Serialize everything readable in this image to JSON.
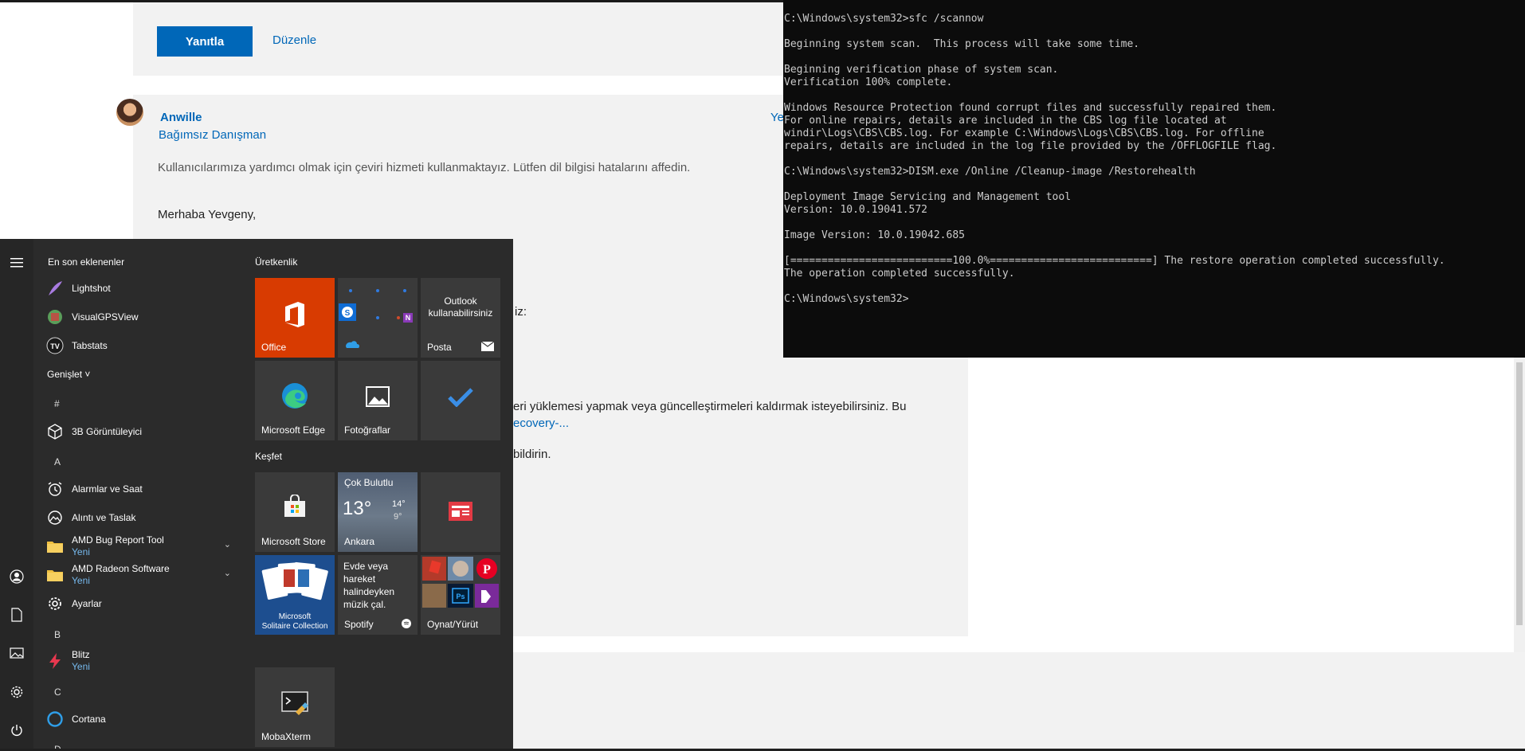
{
  "forum": {
    "reply_button": "Yanıtla",
    "edit_link": "Düzenle",
    "author_name": "Anwille",
    "author_role": "Bağımsız Danışman",
    "reply_edge": "Ye",
    "translation_note": "Kullanıcılarımıza yardımcı olmak için çeviri hizmeti kullanmaktayız. Lütfen dil bilgisi hatalarını affedin.",
    "greeting": "Merhaba Yevgeny,",
    "frag_1": "iz:",
    "frag_2": "eri yüklemesi yapmak veya güncelleştirmeleri kaldırmak isteyebilirsiniz. Bu",
    "frag_3": "ecovery-...",
    "frag_4": "bildirin."
  },
  "console": {
    "lines": [
      "C:\\Windows\\system32>sfc /scannow",
      "",
      "Beginning system scan.  This process will take some time.",
      "",
      "Beginning verification phase of system scan.",
      "Verification 100% complete.",
      "",
      "Windows Resource Protection found corrupt files and successfully repaired them.",
      "For online repairs, details are included in the CBS log file located at",
      "windir\\Logs\\CBS\\CBS.log. For example C:\\Windows\\Logs\\CBS\\CBS.log. For offline",
      "repairs, details are included in the log file provided by the /OFFLOGFILE flag.",
      "",
      "C:\\Windows\\system32>DISM.exe /Online /Cleanup-image /Restorehealth",
      "",
      "Deployment Image Servicing and Management tool",
      "Version: 10.0.19041.572",
      "",
      "Image Version: 10.0.19042.685",
      "",
      "[==========================100.0%==========================] The restore operation completed successfully.",
      "The operation completed successfully.",
      "",
      "C:\\Windows\\system32>"
    ]
  },
  "start_menu": {
    "recent_header": "En son eklenenler",
    "expand_label": "Genişlet ˅",
    "recent_apps": [
      "Lightshot",
      "VisualGPSView",
      "Tabstats"
    ],
    "letter_hash": "#",
    "letter_a": "A",
    "letter_b": "B",
    "letter_c": "C",
    "letter_d": "D",
    "app_3d": "3B Görüntüleyici",
    "app_alarms": "Alarmlar ve Saat",
    "app_snip": "Alıntı ve Taslak",
    "app_amd_bug": "AMD Bug Report Tool",
    "app_amd_radeon": "AMD Radeon Software",
    "app_settings": "Ayarlar",
    "app_blitz": "Blitz",
    "app_cortana": "Cortana",
    "new_badge": "Yeni",
    "productivity_header": "Üretkenlik",
    "explore_header": "Keşfet",
    "tile_office": "Office",
    "tile_outlook_line1": "Outlook",
    "tile_outlook_line2": "kullanabilirsiniz",
    "tile_mail": "Posta",
    "tile_edge": "Microsoft Edge",
    "tile_photos": "Fotoğraflar",
    "tile_store": "Microsoft Store",
    "weather_condition": "Çok Bulutlu",
    "weather_temp": "13°",
    "weather_high": "14°",
    "weather_low": "9°",
    "weather_city": "Ankara",
    "tile_solitaire_line1": "Microsoft",
    "tile_solitaire_line2": "Solitaire Collection",
    "spotify_text": "Evde veya hareket halindeyken müzik çal.",
    "tile_spotify": "Spotify",
    "tile_play": "Oynat/Yürüt",
    "tile_mobaxterm": "MobaXterm",
    "colors": {
      "office": "#d83b01",
      "accent_blue": "#0067b8",
      "new_badge": "#76b9ed"
    }
  }
}
